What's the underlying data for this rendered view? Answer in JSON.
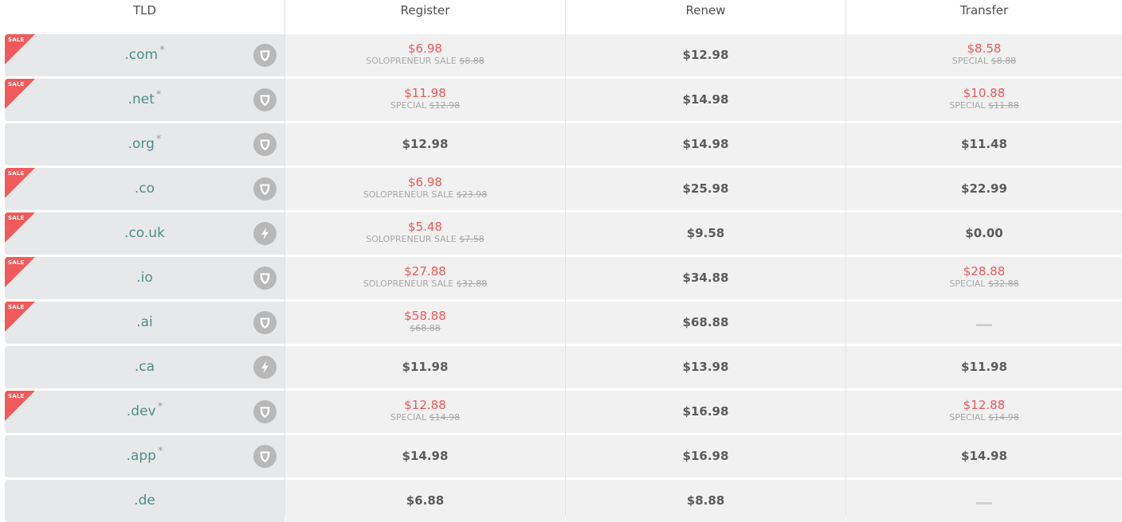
{
  "header": {
    "tld": "TLD",
    "register": "Register",
    "renew": "Renew",
    "transfer": "Transfer"
  },
  "sale_badge": "SALE",
  "rows": [
    {
      "tld": ".com",
      "star": "*",
      "sale": true,
      "icon": "shield-icon",
      "register": {
        "price": "$6.98",
        "label": "SOLOPRENEUR SALE",
        "old": "$8.88"
      },
      "renew": "$12.98",
      "transfer": {
        "price": "$8.58",
        "label": "SPECIAL",
        "old": "$8.88"
      }
    },
    {
      "tld": ".net",
      "star": "*",
      "sale": true,
      "icon": "shield-icon",
      "register": {
        "price": "$11.98",
        "label": "SPECIAL",
        "old": "$12.98"
      },
      "renew": "$14.98",
      "transfer": {
        "price": "$10.88",
        "label": "SPECIAL",
        "old": "$11.88"
      }
    },
    {
      "tld": ".org",
      "star": "*",
      "sale": false,
      "icon": "shield-icon",
      "register": {
        "price": "$12.98"
      },
      "renew": "$14.98",
      "transfer": {
        "price": "$11.48"
      }
    },
    {
      "tld": ".co",
      "star": "",
      "sale": true,
      "icon": "shield-icon",
      "register": {
        "price": "$6.98",
        "label": "SOLOPRENEUR SALE",
        "old": "$23.98"
      },
      "renew": "$25.98",
      "transfer": {
        "price": "$22.99"
      }
    },
    {
      "tld": ".co.uk",
      "star": "",
      "sale": true,
      "icon": "lightning-icon",
      "register": {
        "price": "$5.48",
        "label": "SOLOPRENEUR SALE",
        "old": "$7.58"
      },
      "renew": "$9.58",
      "transfer": {
        "price": "$0.00"
      }
    },
    {
      "tld": ".io",
      "star": "",
      "sale": true,
      "icon": "shield-icon",
      "register": {
        "price": "$27.88",
        "label": "SOLOPRENEUR SALE",
        "old": "$32.88"
      },
      "renew": "$34.88",
      "transfer": {
        "price": "$28.88",
        "label": "SPECIAL",
        "old": "$32.88"
      }
    },
    {
      "tld": ".ai",
      "star": "",
      "sale": true,
      "icon": "shield-icon",
      "register": {
        "price": "$58.88",
        "label": "",
        "old": "$68.88"
      },
      "renew": "$68.88",
      "transfer": {
        "dash": true
      }
    },
    {
      "tld": ".ca",
      "star": "",
      "sale": false,
      "icon": "lightning-icon",
      "register": {
        "price": "$11.98"
      },
      "renew": "$13.98",
      "transfer": {
        "price": "$11.98"
      }
    },
    {
      "tld": ".dev",
      "star": "*",
      "sale": true,
      "icon": "shield-icon",
      "register": {
        "price": "$12.88",
        "label": "SPECIAL",
        "old": "$14.98"
      },
      "renew": "$16.98",
      "transfer": {
        "price": "$12.88",
        "label": "SPECIAL",
        "old": "$14.98"
      }
    },
    {
      "tld": ".app",
      "star": "*",
      "sale": false,
      "icon": "shield-icon",
      "register": {
        "price": "$14.98"
      },
      "renew": "$16.98",
      "transfer": {
        "price": "$14.98"
      }
    },
    {
      "tld": ".de",
      "star": "",
      "sale": false,
      "icon": "",
      "register": {
        "price": "$6.88"
      },
      "renew": "$8.88",
      "transfer": {
        "dash": true
      }
    }
  ],
  "colors": {
    "sale_red": "#ef5a5a",
    "tld_teal": "#4e8e8a",
    "row_bg": "#f1f1f1",
    "tld_bg": "#e7e8e9",
    "icon_gray": "#b8b8b8"
  }
}
